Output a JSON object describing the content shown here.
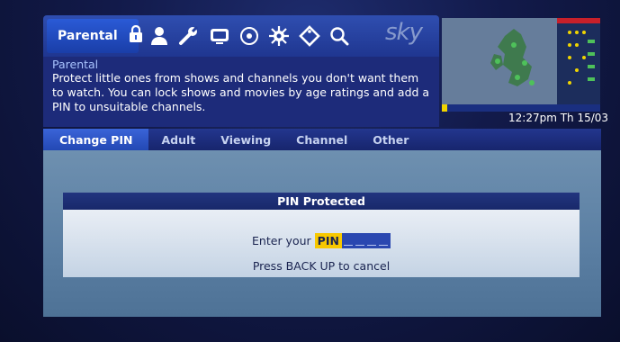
{
  "menu": {
    "active_label": "Parental",
    "icons": [
      "lock-icon",
      "person-icon",
      "wrench-icon",
      "tv-icon",
      "disc-icon",
      "gear-sun-icon",
      "tag-icon",
      "search-icon"
    ],
    "brand": "sky"
  },
  "description": {
    "title": "Parental",
    "body": "Protect little ones from shows and channels you don't want them to watch. You can lock shows and movies by age ratings and add a PIN to unsuitable channels."
  },
  "clock": "12:27pm Th 15/03",
  "tabs": [
    "Change PIN",
    "Adult",
    "Viewing",
    "Channel",
    "Other"
  ],
  "dialog": {
    "title": "PIN Protected",
    "prompt": "Enter your",
    "pin_label": "PIN",
    "hint": "Press BACK UP to cancel"
  },
  "colors": {
    "accent_yellow": "#f7c800",
    "menu_blue": "#2f4eb0",
    "selected_tab": "#3a64d8"
  }
}
